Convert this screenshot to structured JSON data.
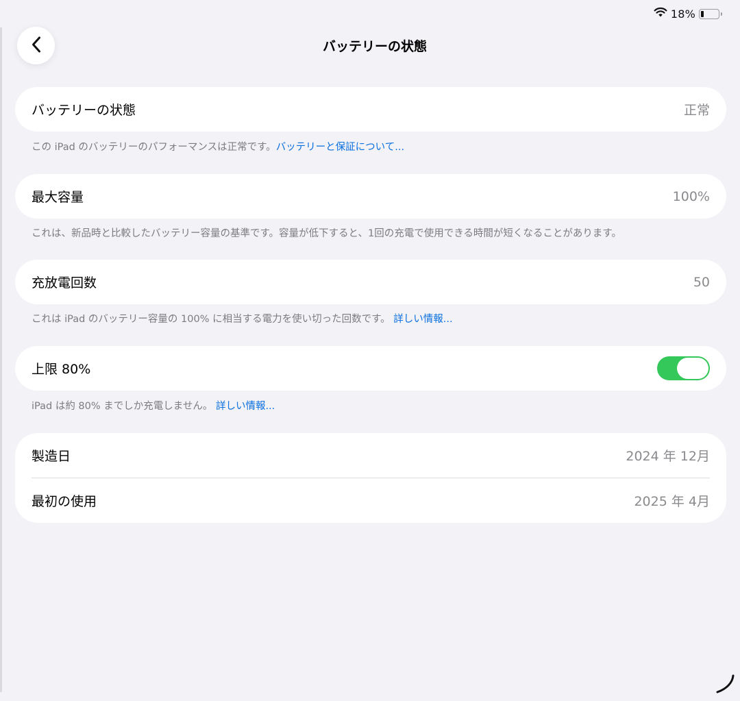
{
  "status_bar": {
    "battery_percent": "18%",
    "battery_level": 0.18
  },
  "header": {
    "title": "バッテリーの状態"
  },
  "health": {
    "label": "バッテリーの状態",
    "value": "正常",
    "note": "この iPad のバッテリーのパフォーマンスは正常です。",
    "link": "バッテリーと保証について..."
  },
  "capacity": {
    "label": "最大容量",
    "value": "100%",
    "note": "これは、新品時と比較したバッテリー容量の基準です。容量が低下すると、1回の充電で使用できる時間が短くなることがあります。"
  },
  "cycles": {
    "label": "充放電回数",
    "value": "50",
    "note": "これは iPad のバッテリー容量の 100% に相当する電力を使い切った回数です。",
    "link": "詳しい情報..."
  },
  "limit": {
    "label": "上限 80%",
    "toggle_on": true,
    "note": "iPad は約 80% までしか充電しません。",
    "link": "詳しい情報..."
  },
  "dates": {
    "manufactured_label": "製造日",
    "manufactured_value": "2024 年 12月",
    "first_use_label": "最初の使用",
    "first_use_value": "2025 年 4月"
  },
  "colors": {
    "accent_link": "#0a6fe0",
    "toggle_on": "#34c759",
    "background": "#f2f2f7"
  }
}
